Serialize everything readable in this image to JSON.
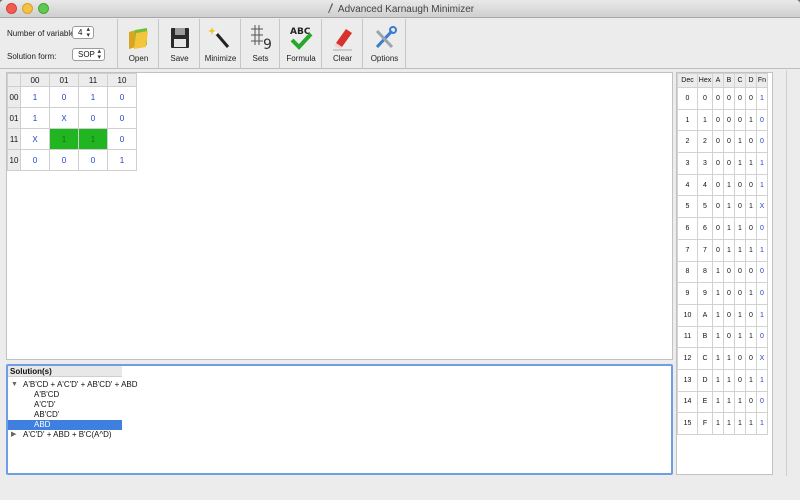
{
  "window": {
    "title": "Advanced Karnaugh Minimizer"
  },
  "toolbar": {
    "num_vars_label": "Number of variables:",
    "num_vars_value": "4",
    "solution_form_label": "Solution form:",
    "solution_form_value": "SOP",
    "buttons": [
      {
        "label": "Open",
        "icon": "folder-open-icon"
      },
      {
        "label": "Save",
        "icon": "floppy-disk-icon"
      },
      {
        "label": "Minimize",
        "icon": "magic-wand-icon"
      },
      {
        "label": "Sets",
        "icon": "sets-grid-icon"
      },
      {
        "label": "Formula",
        "icon": "abc-check-icon"
      },
      {
        "label": "Clear",
        "icon": "eraser-icon"
      },
      {
        "label": "Options",
        "icon": "tools-icon"
      }
    ]
  },
  "kmap": {
    "col_headers": [
      "00",
      "01",
      "11",
      "10"
    ],
    "row_headers": [
      "00",
      "01",
      "11",
      "10"
    ],
    "cells": [
      [
        "1",
        "0",
        "1",
        "0"
      ],
      [
        "1",
        "X",
        "0",
        "0"
      ],
      [
        "X",
        "1",
        "1",
        "0"
      ],
      [
        "0",
        "0",
        "0",
        "1"
      ]
    ],
    "highlight_color": "#22b522"
  },
  "solutions": {
    "header": "Solution(s)",
    "expanded": {
      "expression": "A'B'CD + A'C'D' + AB'CD' + ABD",
      "terms": [
        "A'B'CD",
        "A'C'D'",
        "AB'CD'",
        "ABD"
      ],
      "selected_term": "ABD"
    },
    "collapsed": {
      "expression": "A'C'D'  +  ABD + B'C(A^D)"
    }
  },
  "truth_table": {
    "headers": [
      "Dec",
      "Hex",
      "A",
      "B",
      "C",
      "D",
      "Fn"
    ],
    "rows": [
      [
        "0",
        "0",
        "0",
        "0",
        "0",
        "0",
        "1"
      ],
      [
        "1",
        "1",
        "0",
        "0",
        "0",
        "1",
        "0"
      ],
      [
        "2",
        "2",
        "0",
        "0",
        "1",
        "0",
        "0"
      ],
      [
        "3",
        "3",
        "0",
        "0",
        "1",
        "1",
        "1"
      ],
      [
        "4",
        "4",
        "0",
        "1",
        "0",
        "0",
        "1"
      ],
      [
        "5",
        "5",
        "0",
        "1",
        "0",
        "1",
        "X"
      ],
      [
        "6",
        "6",
        "0",
        "1",
        "1",
        "0",
        "0"
      ],
      [
        "7",
        "7",
        "0",
        "1",
        "1",
        "1",
        "1"
      ],
      [
        "8",
        "8",
        "1",
        "0",
        "0",
        "0",
        "0"
      ],
      [
        "9",
        "9",
        "1",
        "0",
        "0",
        "1",
        "0"
      ],
      [
        "10",
        "A",
        "1",
        "0",
        "1",
        "0",
        "1"
      ],
      [
        "11",
        "B",
        "1",
        "0",
        "1",
        "1",
        "0"
      ],
      [
        "12",
        "C",
        "1",
        "1",
        "0",
        "0",
        "X"
      ],
      [
        "13",
        "D",
        "1",
        "1",
        "0",
        "1",
        "1"
      ],
      [
        "14",
        "E",
        "1",
        "1",
        "1",
        "0",
        "0"
      ],
      [
        "15",
        "F",
        "1",
        "1",
        "1",
        "1",
        "1"
      ]
    ]
  },
  "colors": {
    "accent": "#3f7fe0",
    "value_blue": "#1e3fcc",
    "group_green": "#22b522"
  }
}
